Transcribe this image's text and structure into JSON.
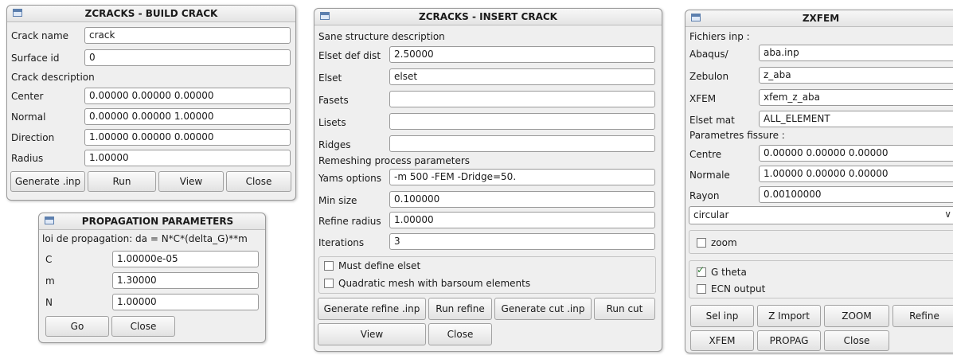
{
  "build_crack": {
    "title": "ZCRACKS - BUILD CRACK",
    "crack_name_label": "Crack name",
    "crack_name_value": "crack",
    "surface_id_label": "Surface id",
    "surface_id_value": "0",
    "crack_description_label": "Crack description",
    "center_label": "Center",
    "center_value": "0.00000 0.00000 0.00000",
    "normal_label": "Normal",
    "normal_value": "0.00000 0.00000 1.00000",
    "direction_label": "Direction",
    "direction_value": "1.00000 0.00000 0.00000",
    "radius_label": "Radius",
    "radius_value": "1.00000",
    "buttons": {
      "generate": "Generate .inp",
      "run": "Run",
      "view": "View",
      "close": "Close"
    }
  },
  "propagation": {
    "title": "PROPAGATION PARAMETERS",
    "law_label": "loi de propagation: da = N*C*(delta_G)**m",
    "c_label": "C",
    "c_value": "1.00000e-05",
    "m_label": "m",
    "m_value": "1.30000",
    "n_label": "N",
    "n_value": "1.00000",
    "buttons": {
      "go": "Go",
      "close": "Close"
    }
  },
  "insert_crack": {
    "title": "ZCRACKS - INSERT CRACK",
    "sane_label": "Sane structure description",
    "elset_def_dist_label": "Elset def dist",
    "elset_def_dist_value": "2.50000",
    "elset_label": "Elset",
    "elset_value": "elset",
    "fasets_label": "Fasets",
    "fasets_value": "",
    "lisets_label": "Lisets",
    "lisets_value": "",
    "ridges_label": "Ridges",
    "ridges_value": "",
    "remeshing_label": "Remeshing process parameters",
    "yams_label": "Yams options",
    "yams_value": "-m 500 -FEM -Dridge=50.",
    "min_size_label": "Min size",
    "min_size_value": "0.100000",
    "refine_radius_label": "Refine radius",
    "refine_radius_value": "1.00000",
    "iterations_label": "Iterations",
    "iterations_value": "3",
    "must_define_label": "Must define elset",
    "must_define_checked": false,
    "quadratic_label": "Quadratic mesh with barsoum elements",
    "quadratic_checked": false,
    "buttons": {
      "generate_refine": "Generate refine .inp",
      "run_refine": "Run refine",
      "generate_cut": "Generate cut .inp",
      "run_cut": "Run cut",
      "view": "View",
      "close": "Close"
    }
  },
  "zxfem": {
    "title": "ZXFEM",
    "fichiers_label": "Fichiers inp :",
    "abaqus_label": "Abaqus/",
    "abaqus_value": "aba.inp",
    "zebulon_label": "Zebulon",
    "zebulon_value": "z_aba",
    "xfem_label": "XFEM",
    "xfem_value": "xfem_z_aba",
    "elset_mat_label": "Elset mat",
    "elset_mat_value": "ALL_ELEMENT",
    "parametres_label": "Parametres fissure :",
    "centre_label": "Centre",
    "centre_value": "0.00000 0.00000 0.00000",
    "normale_label": "Normale",
    "normale_value": "1.00000 0.00000 0.00000",
    "rayon_label": "Rayon",
    "rayon_value": "0.00100000",
    "shape_selected": "circular",
    "zoom_label": "zoom",
    "zoom_checked": false,
    "gtheta_label": "G theta",
    "gtheta_checked": true,
    "ecn_label": "ECN output",
    "ecn_checked": false,
    "buttons": {
      "sel_inp": "Sel inp",
      "z_import": "Z Import",
      "zoom": "ZOOM",
      "refine": "Refine",
      "xfem": "XFEM",
      "propag": "PROPAG",
      "close": "Close"
    }
  }
}
